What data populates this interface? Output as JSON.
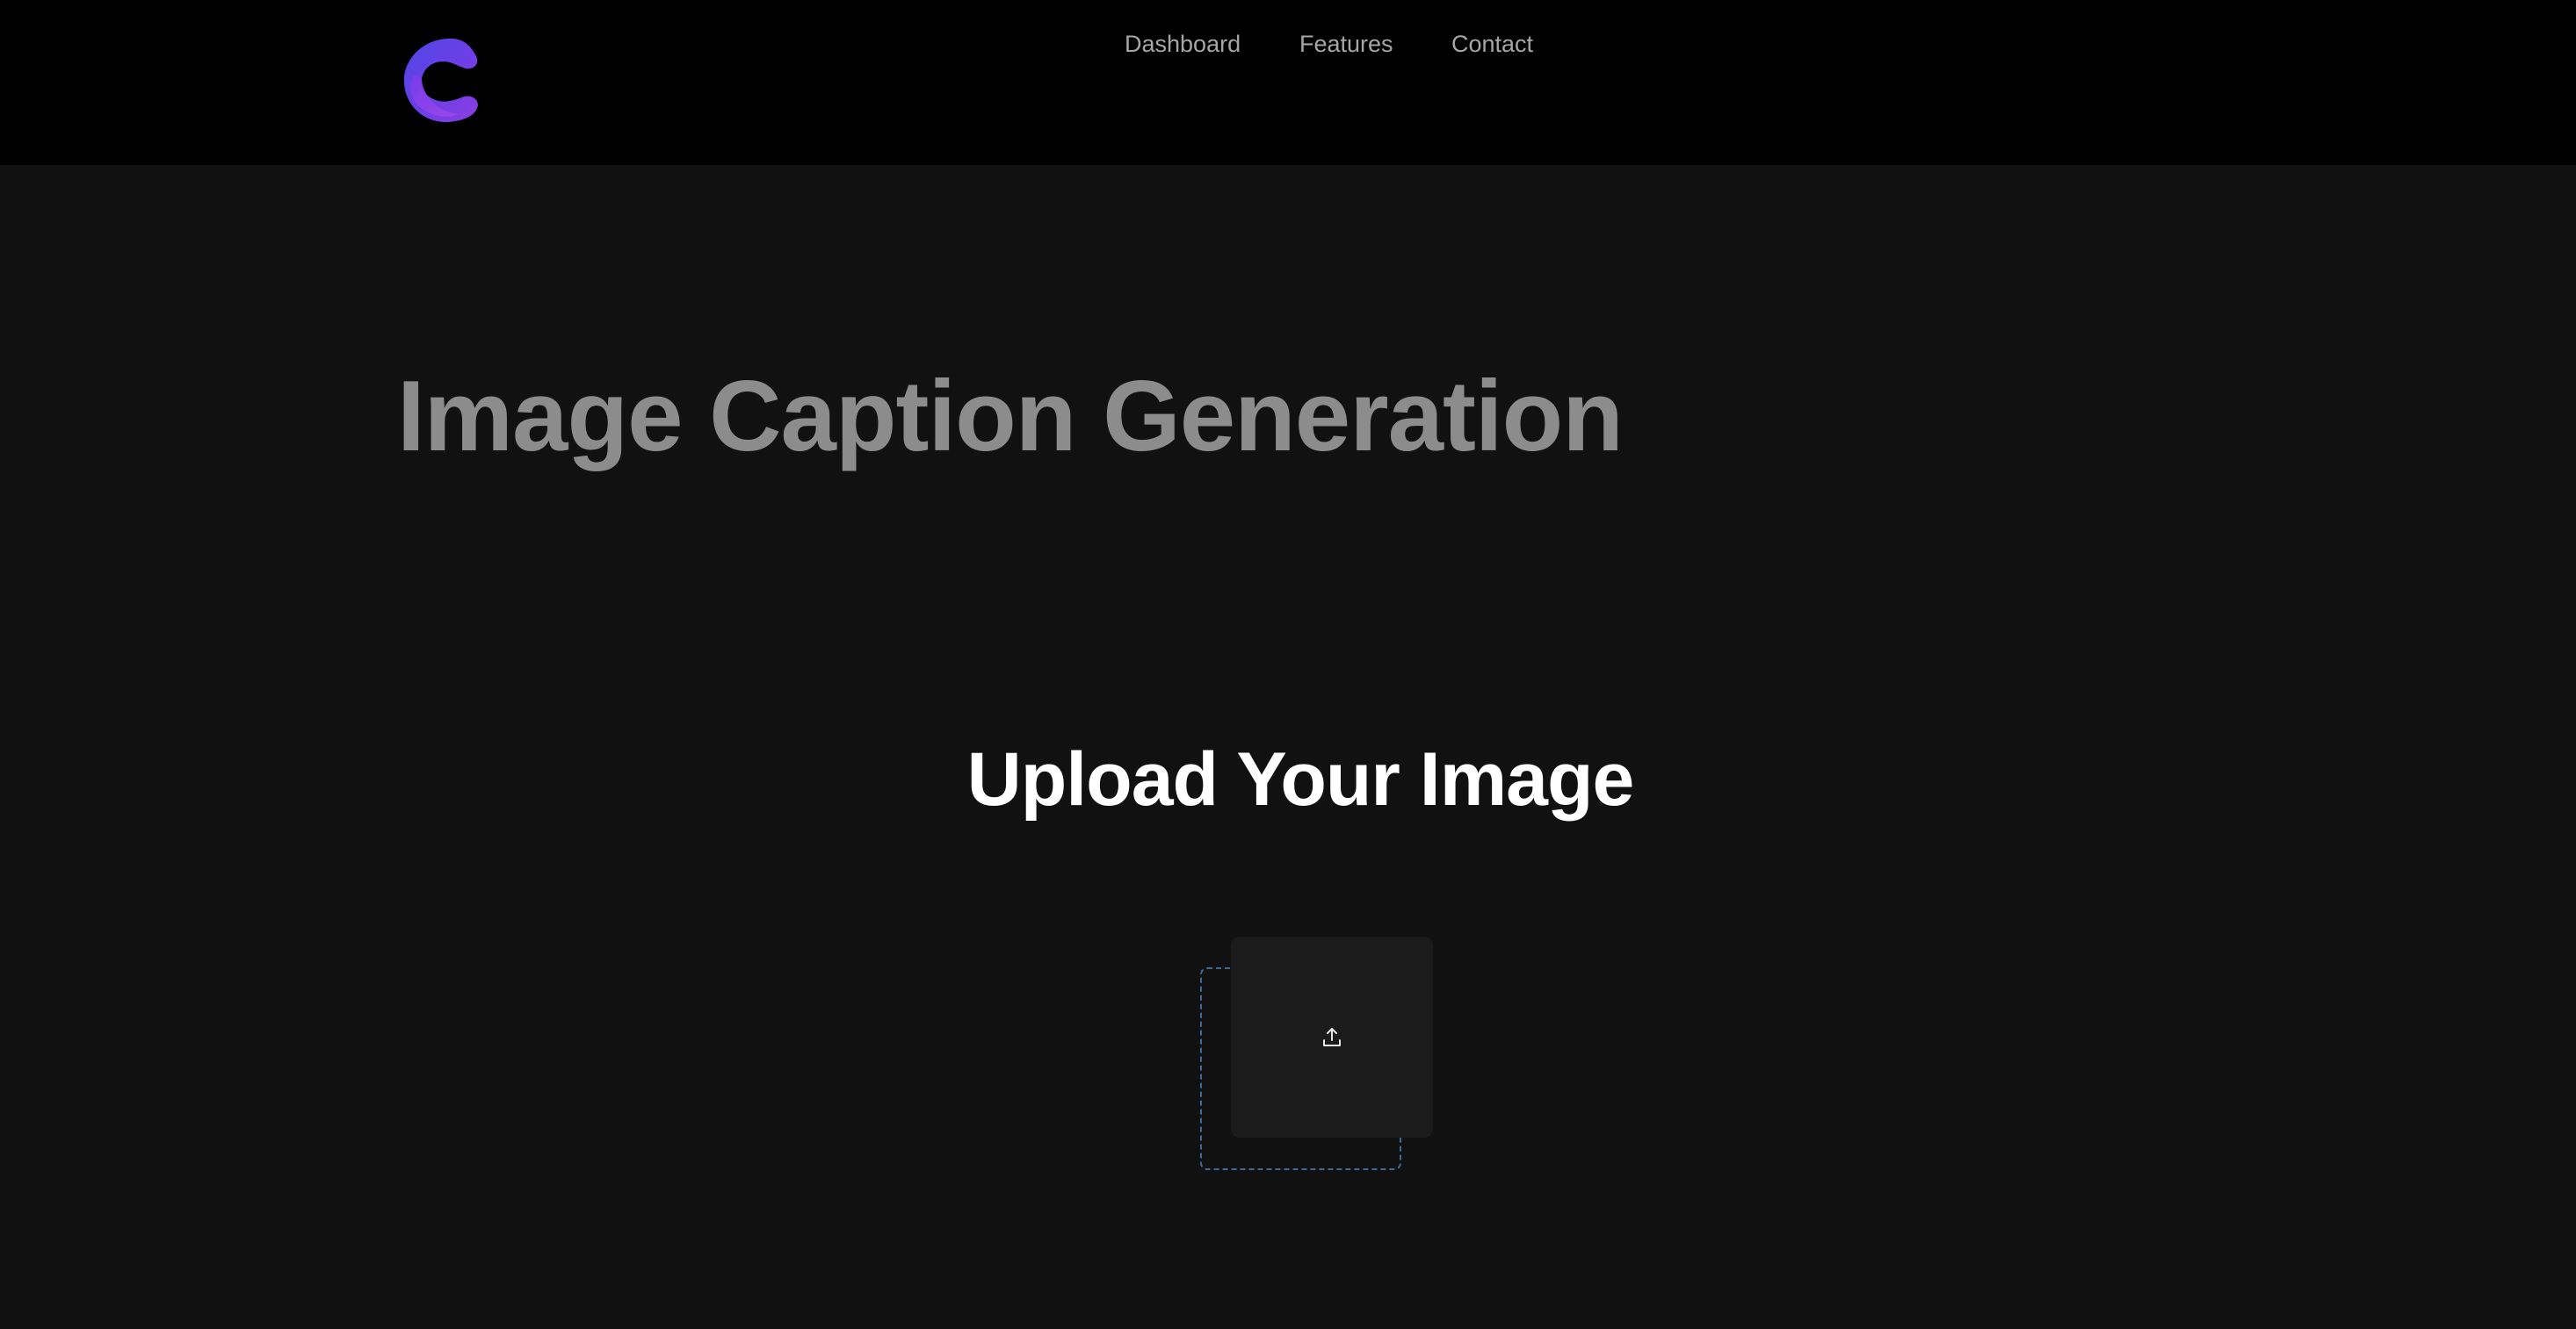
{
  "header": {
    "logo_icon": "c-logo-icon",
    "nav": {
      "dashboard": "Dashboard",
      "features": "Features",
      "contact": "Contact"
    }
  },
  "hero": {
    "title": "Image Caption Generation"
  },
  "upload": {
    "heading": "Upload Your Image",
    "icon": "upload-icon"
  },
  "colors": {
    "page_background": "#111111",
    "header_background": "#000000",
    "logo_gradient_start": "#3b5bdb",
    "logo_gradient_end": "#9b3fe0",
    "nav_text": "#a6a6a6",
    "hero_title": "#8c8c8c",
    "upload_heading": "#ffffff",
    "dropzone_border": "#3c6c96",
    "upload_card": "#1b1b1b"
  }
}
